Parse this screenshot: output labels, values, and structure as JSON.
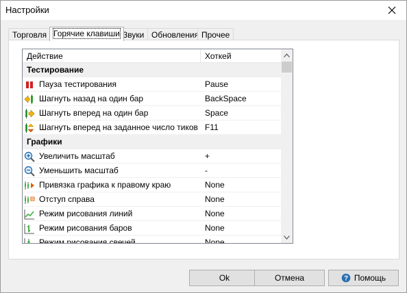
{
  "window": {
    "title": "Настройки"
  },
  "tabs": [
    {
      "label": "Торговля"
    },
    {
      "label": "Горячие клавиши"
    },
    {
      "label": "Звуки"
    },
    {
      "label": "Обновления"
    },
    {
      "label": "Прочее"
    }
  ],
  "table": {
    "columns": [
      "Действие",
      "Хоткей"
    ],
    "rows": [
      {
        "label": "Тестирование"
      },
      {
        "label": "Пауза тестирования",
        "key": "Pause",
        "icon": "pause-icon"
      },
      {
        "label": "Шагнуть назад на один бар",
        "key": "BackSpace",
        "icon": "step-back-icon"
      },
      {
        "label": "Шагнуть вперед на один бар",
        "key": "Space",
        "icon": "step-forward-icon"
      },
      {
        "label": "Шагнуть вперед на заданное число тиков",
        "key": "F11",
        "icon": "step-ticks-icon"
      },
      {
        "label": "Графики"
      },
      {
        "label": "Увеличить масштаб",
        "key": "+",
        "icon": "zoom-in-icon"
      },
      {
        "label": "Уменьшить масштаб",
        "key": "-",
        "icon": "zoom-out-icon"
      },
      {
        "label": "Привязка графика к правому краю",
        "key": "None",
        "icon": "chart-autoscroll-icon"
      },
      {
        "label": "Отступ справа",
        "key": "None",
        "icon": "chart-shift-icon"
      },
      {
        "label": "Режим рисования линий",
        "key": "None",
        "icon": "line-chart-icon"
      },
      {
        "label": "Режим рисования баров",
        "key": "None",
        "icon": "bar-chart-icon"
      },
      {
        "label": "Режим рисования свечей",
        "key": "None",
        "icon": "candle-chart-icon"
      }
    ]
  },
  "buttons": {
    "ok": "Ok",
    "cancel": "Отмена",
    "help": "Помощь"
  }
}
